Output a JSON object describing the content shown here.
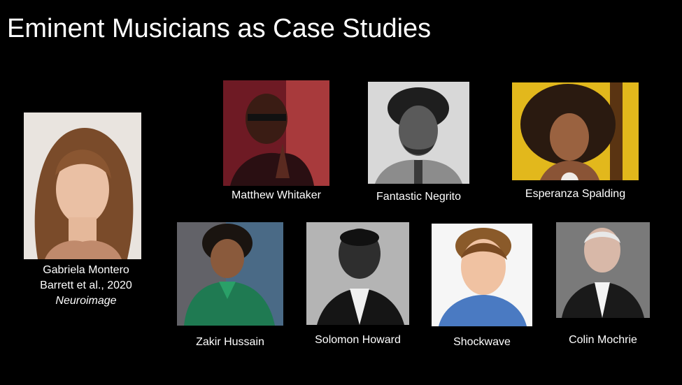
{
  "slide": {
    "title": "Eminent Musicians as Case Studies"
  },
  "featured": {
    "name": "Gabriela Montero",
    "citation": "Barrett et al., 2020",
    "journal": "Neuroimage"
  },
  "musicians": [
    {
      "name": "Matthew Whitaker"
    },
    {
      "name": "Fantastic Negrito"
    },
    {
      "name": "Esperanza Spalding"
    },
    {
      "name": "Zakir Hussain"
    },
    {
      "name": "Solomon Howard"
    },
    {
      "name": "Shockwave"
    },
    {
      "name": "Colin Mochrie"
    }
  ]
}
